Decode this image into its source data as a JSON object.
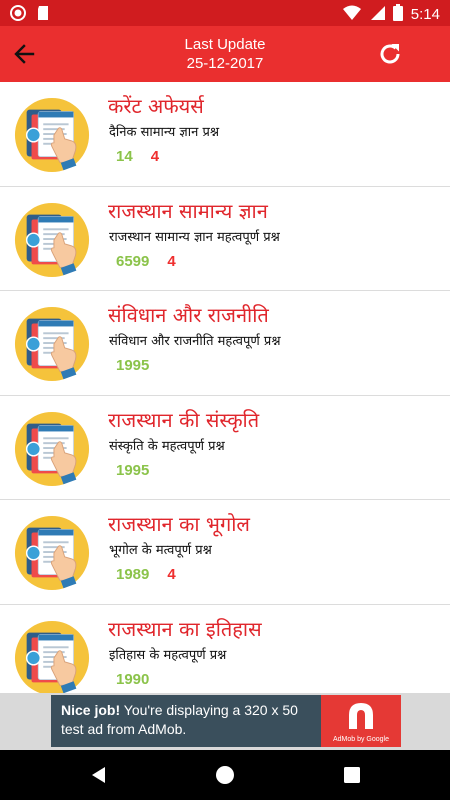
{
  "status_bar": {
    "time": "5:14"
  },
  "app_bar": {
    "title_line1": "Last Update",
    "title_line2": "25-12-2017"
  },
  "items": [
    {
      "title": "करेंट अफेयर्स",
      "subtitle": "दैनिक सामान्य ज्ञान प्रश्न",
      "count_green": "14",
      "count_red": "4"
    },
    {
      "title": "राजस्थान सामान्य ज्ञान",
      "subtitle": "राजस्थान सामान्य ज्ञान महत्वपूर्ण प्रश्न",
      "count_green": "6599",
      "count_red": "4"
    },
    {
      "title": "संविधान और राजनीति",
      "subtitle": "संविधान और राजनीति महत्वपूर्ण प्रश्न",
      "count_green": "1995",
      "count_red": ""
    },
    {
      "title": "राजस्थान की संस्कृति",
      "subtitle": "संस्कृति के महत्वपूर्ण प्रश्न",
      "count_green": "1995",
      "count_red": ""
    },
    {
      "title": "राजस्थान का भूगोल",
      "subtitle": "भूगोल के मत्वपूर्ण प्रश्न",
      "count_green": "1989",
      "count_red": "4"
    },
    {
      "title": "राजस्थान का इतिहास",
      "subtitle": "इतिहास के महत्वपूर्ण प्रश्न",
      "count_green": "1990",
      "count_red": ""
    }
  ],
  "ad": {
    "bold": "Nice job!",
    "text": " You're displaying a 320 x 50 test ad from AdMob.",
    "caption": "AdMob by Google"
  },
  "colors": {
    "status": "#d01c1f",
    "appbar": "#ea2f2f",
    "title_red": "#e0262c",
    "count_green": "#8bc34a",
    "count_red": "#ef2f2f"
  }
}
